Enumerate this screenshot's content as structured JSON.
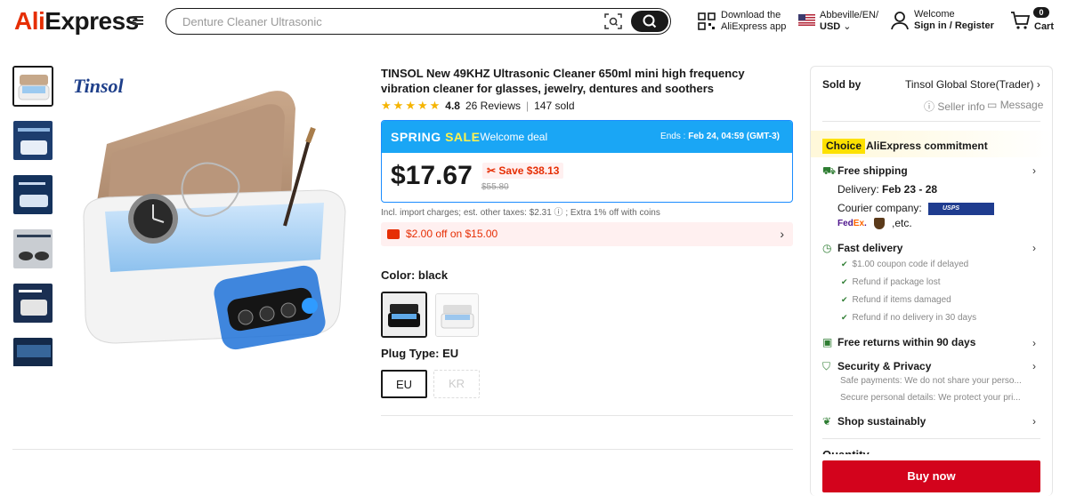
{
  "header": {
    "logo": {
      "ali": "Ali",
      "express": "Express"
    },
    "search_placeholder": "Denture Cleaner Ultrasonic",
    "app_line1": "Download the",
    "app_line2": "AliExpress app",
    "locale_line1": "Abbeville/EN/",
    "locale_line2": "USD",
    "welcome": "Welcome",
    "sign_in": "Sign in / Register",
    "cart_count": "0",
    "cart_label": "Cart"
  },
  "product": {
    "brand": "Tinsol",
    "title": "TINSOL New 49KHZ Ultrasonic Cleaner 650ml mini high frequency vibration cleaner for glasses, jewelry, dentures and soothers",
    "rating": "4.8",
    "reviews": "26 Reviews",
    "sold": "147 sold",
    "stars": 5
  },
  "deal": {
    "sale_a": "SPRING ",
    "sale_b": "SALE",
    "welcome": "· Welcome deal",
    "ends_label": "Ends :",
    "ends_value": "Feb 24, 04:59 (GMT-3)",
    "price": "$17.67",
    "save": "Save $38.13",
    "original": "$55.80",
    "tax_note": "Incl. import charges; est. other taxes: $2.31 ⓘ ; Extra 1% off with coins",
    "coupon": "$2.00 off on $15.00"
  },
  "options": {
    "color_label": "Color: black",
    "plug_label": "Plug Type: EU",
    "plugs": [
      "EU",
      "KR"
    ]
  },
  "seller": {
    "sold_by": "Sold by",
    "store": "Tinsol Global Store(Trader)",
    "seller_info": "Seller info",
    "message": "Message"
  },
  "commitment": {
    "choice": "Choice",
    "title": "AliExpress commitment",
    "free_shipping": "Free shipping",
    "delivery_label": "Delivery: ",
    "delivery_value": "Feb 23 - 28",
    "courier": "Courier company:",
    "courier_etc": ",etc.",
    "fast_delivery": "Fast delivery",
    "fast_items": [
      "$1.00 coupon code if delayed",
      "Refund if package lost",
      "Refund if items damaged",
      "Refund if no delivery in 30 days"
    ],
    "free_returns": "Free returns within 90 days",
    "security": "Security & Privacy",
    "security_items": [
      "Safe payments: We do not share your perso...",
      "Secure personal details: We protect your pri..."
    ],
    "sustainably": "Shop sustainably",
    "quantity_partial": "Quantity",
    "buy_now": "Buy now"
  },
  "colors": {
    "brand": "#e62e04",
    "deal_blue": "#1aa6f5",
    "buy": "#d3031c",
    "choice": "#fde100"
  }
}
